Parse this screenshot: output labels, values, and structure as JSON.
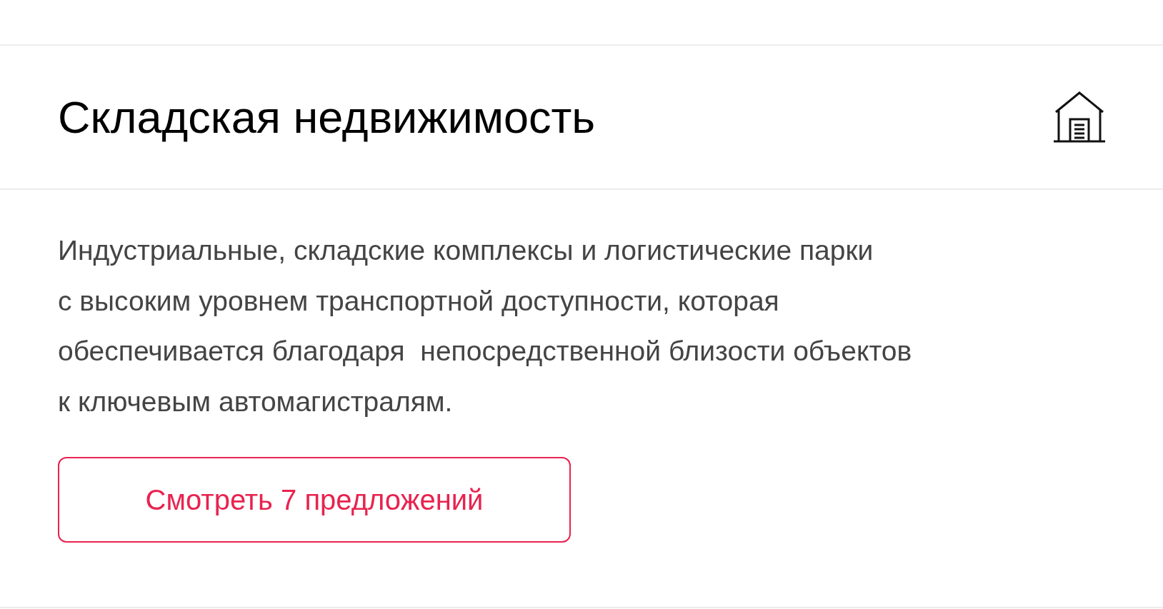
{
  "card": {
    "title": "Складская недвижимость",
    "description": "Индустриальные, складские комплексы и логистические парки\nс высоким уровнем транспортной доступности, которая\nобеспечивается благодаря  непосредственной близости объектов\nк ключевым автомагистралям.",
    "button": "Смотреть 7 предложений"
  }
}
